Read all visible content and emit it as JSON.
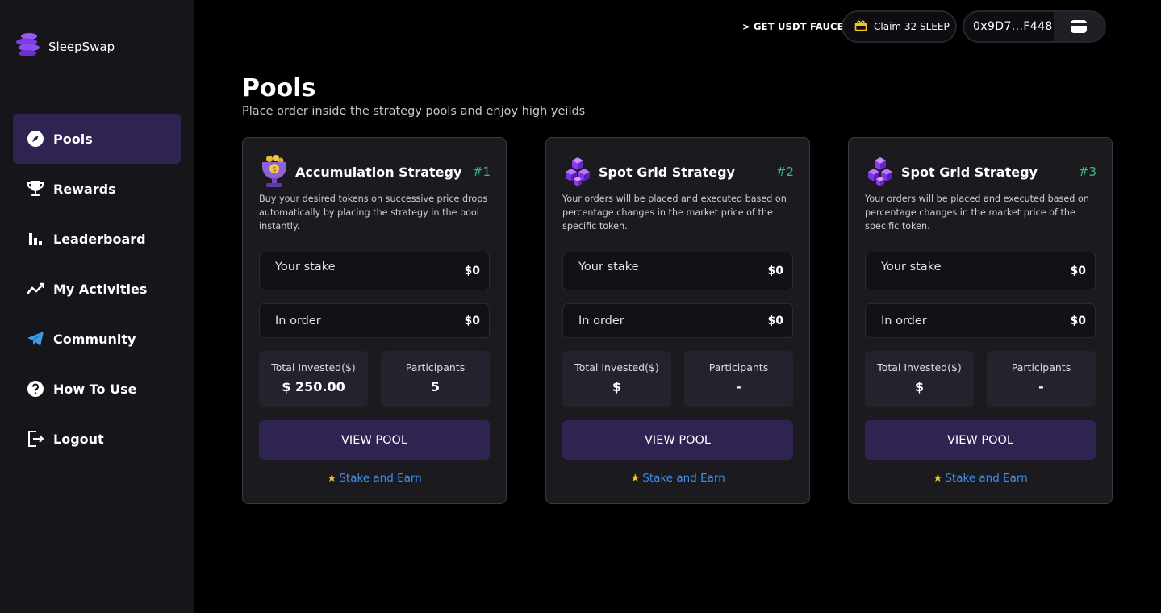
{
  "brand": {
    "name": "SleepSwap",
    "logo_icon": "sleepswap-logo-icon"
  },
  "sidebar": {
    "items": [
      {
        "label": "Pools",
        "icon": "compass-icon",
        "active": true
      },
      {
        "label": "Rewards",
        "icon": "trophy-icon",
        "active": false
      },
      {
        "label": "Leaderboard",
        "icon": "bar-chart-icon",
        "active": false
      },
      {
        "label": "My Activities",
        "icon": "trend-line-icon",
        "active": false
      },
      {
        "label": "Community",
        "icon": "telegram-icon",
        "active": false
      },
      {
        "label": "How To Use",
        "icon": "help-circle-icon",
        "active": false
      },
      {
        "label": "Logout",
        "icon": "logout-icon",
        "active": false
      }
    ]
  },
  "topbar": {
    "faucet_label": "> GET USDT FAUCET",
    "claim_label": "Claim 32 SLEEP",
    "wallet_address": "0x9D7...F448"
  },
  "page": {
    "title": "Pools",
    "subtitle": "Place order inside the strategy pools and enjoy high yeilds"
  },
  "pools": [
    {
      "title": "Accumulation Strategy",
      "number": "#1",
      "icon": "trophy-coins-icon",
      "description": "Buy your desired tokens on successive price drops automatically by placing the strategy in the pool instantly.",
      "stake_label": "Your stake",
      "stake_value": "$0",
      "order_label": "In order",
      "order_value": "$0",
      "invested_label": "Total Invested($)",
      "invested_value": "$ 250.00",
      "participants_label": "Participants",
      "participants_value": "5",
      "button_label": "VIEW POOL",
      "link_label": "Stake and Earn"
    },
    {
      "title": "Spot Grid Strategy",
      "number": "#2",
      "icon": "purple-cubes-icon",
      "description": "Your orders will be placed and executed based on percentage changes in the market price of the specific token.",
      "stake_label": "Your stake",
      "stake_value": "$0",
      "order_label": "In order",
      "order_value": "$0",
      "invested_label": "Total Invested($)",
      "invested_value": "$",
      "participants_label": "Participants",
      "participants_value": "-",
      "button_label": "VIEW POOL",
      "link_label": "Stake and Earn"
    },
    {
      "title": "Spot Grid Strategy",
      "number": "#3",
      "icon": "purple-cubes-icon",
      "description": "Your orders will be placed and executed based on percentage changes in the market price of the specific token.",
      "stake_label": "Your stake",
      "stake_value": "$0",
      "order_label": "In order",
      "order_value": "$0",
      "invested_label": "Total Invested($)",
      "invested_value": "$",
      "participants_label": "Participants",
      "participants_value": "-",
      "button_label": "VIEW POOL",
      "link_label": "Stake and Earn"
    }
  ],
  "colors": {
    "background": "#000000",
    "sidebar": "#15151a",
    "accent": "#2f2352",
    "card": "#1a1a1f",
    "pool_number": "#3dbb7c",
    "link": "#3d8ef0"
  }
}
